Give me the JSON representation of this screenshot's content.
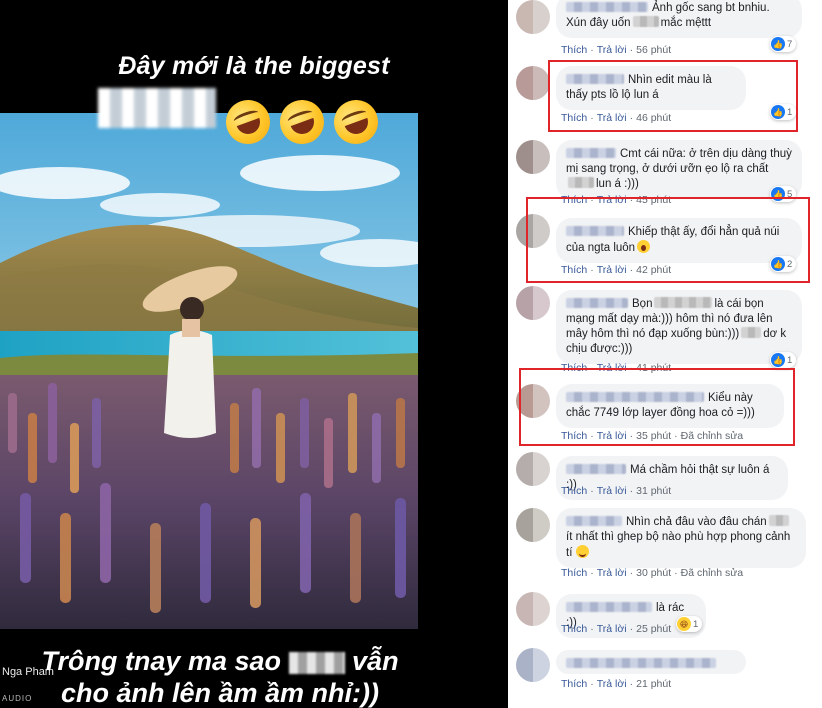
{
  "story": {
    "headline": "Đây mới là the biggest",
    "caption_line1_a": "Trông tnay ma sao",
    "caption_line1_b": "vẫn",
    "caption_line2": "cho ảnh lên ầm ầm nhỉ:))",
    "author": "Nga Pham",
    "author_sub": "AUDIO"
  },
  "comments": [
    {
      "text": "Ảnh gốc sang bt bnhiu. Xún đây uốn",
      "text_b": "mắc mệttt",
      "like_label": "Thích",
      "reply_label": "Trả lời",
      "time": "56 phút",
      "reaction_count": "7"
    },
    {
      "text": "Nhìn edit màu là thấy pts lồ lộ lun á",
      "like_label": "Thích",
      "reply_label": "Trả lời",
      "time": "46 phút",
      "reaction_count": "1"
    },
    {
      "text": "Cmt cái nữa: ở trên dịu dàng thuỳ mị sang trọng, ở dưới ưỡn ẹo lộ ra chất",
      "text_b": "lun á :)))",
      "like_label": "Thích",
      "reply_label": "Trả lời",
      "time": "45 phút",
      "reaction_count": "5"
    },
    {
      "text": "Khiếp thật ấy, đổi hẳn quả núi của ngta luôn",
      "like_label": "Thích",
      "reply_label": "Trả lời",
      "time": "42 phút",
      "reaction_count": "2"
    },
    {
      "text_a": "Bọn",
      "text": "là cái bọn mạng mất dạy mà:))) hôm thì nó đưa lên mây hôm thì nó đạp xuống bùn:)))",
      "text_b": "dơ k chịu được:)))",
      "like_label": "Thích",
      "reply_label": "Trả lời",
      "time": "41 phút",
      "reaction_count": "1"
    },
    {
      "text": "Kiểu này chắc 7749 lớp layer đồng hoa cỏ =)))",
      "like_label": "Thích",
      "reply_label": "Trả lời",
      "time": "35 phút",
      "edited_label": "Đã chỉnh sửa"
    },
    {
      "text": "Má chầm hỏi thật sự luôn á :))",
      "like_label": "Thích",
      "reply_label": "Trả lời",
      "time": "31 phút"
    },
    {
      "text": "Nhìn chả đâu vào đâu chán",
      "text_b": "ít nhất thì ghep bộ nào phù hợp phong cảnh tí",
      "like_label": "Thích",
      "reply_label": "Trả lời",
      "time": "30 phút",
      "edited_label": "Đã chỉnh sửa"
    },
    {
      "text": "là rác :))",
      "like_label": "Thích",
      "reply_label": "Trả lời",
      "time": "25 phút",
      "reaction_count": "1"
    },
    {
      "text": "",
      "like_label": "Thích",
      "reply_label": "Trả lời",
      "time": "21 phút"
    }
  ]
}
